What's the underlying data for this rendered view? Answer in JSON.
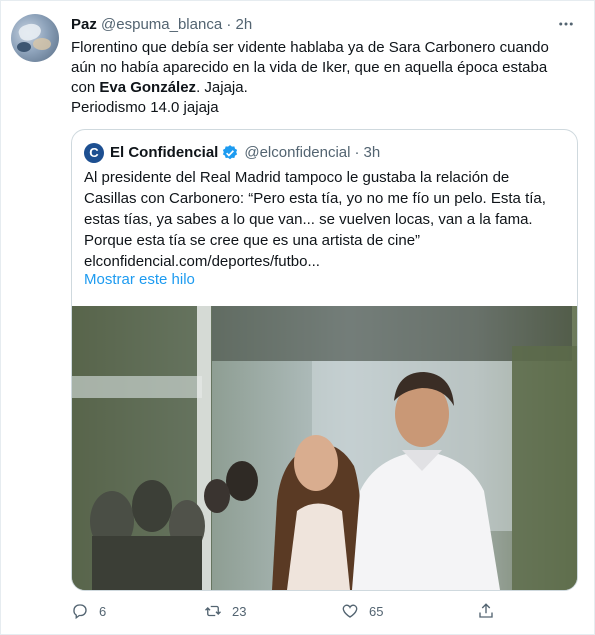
{
  "author": {
    "name": "Paz",
    "handle": "@espuma_blanca",
    "separator": "·",
    "time": "2h"
  },
  "tweet": {
    "line1": "Florentino que debía ser vidente hablaba ya de Sara Carbonero cuando",
    "line2": "aún no había aparecido en la vida de Iker, que en aquella época estaba",
    "line3_prefix": "con ",
    "line3_bold": "Eva González",
    "line3_suffix": ". Jajaja.",
    "line4": "Periodismo 14.0 jajaja"
  },
  "quoted": {
    "logo_letter": "C",
    "name": "El Confidencial",
    "handle": "@elconfidencial",
    "separator": "·",
    "time": "3h",
    "lines": [
      "Al presidente del Real Madrid tampoco le gustaba la relación de",
      "Casillas con Carbonero: “Pero esta tía, yo no me fío un pelo. Esta tía,",
      "estas tías, ya sabes a lo que van... se vuelven locas, van a la fama.",
      "Porque esta tía se cree que es una artista de cine”",
      "elconfidencial.com/deportes/futbo..."
    ],
    "show_thread": "Mostrar este hilo"
  },
  "actions": {
    "replies": "6",
    "retweets": "23",
    "likes": "65"
  },
  "colors": {
    "accent": "#1d9bf0",
    "muted": "#536471",
    "verified": "#1d9bf0"
  },
  "icons": [
    "more-icon",
    "verified-icon",
    "reply-icon",
    "retweet-icon",
    "like-icon",
    "share-icon"
  ]
}
